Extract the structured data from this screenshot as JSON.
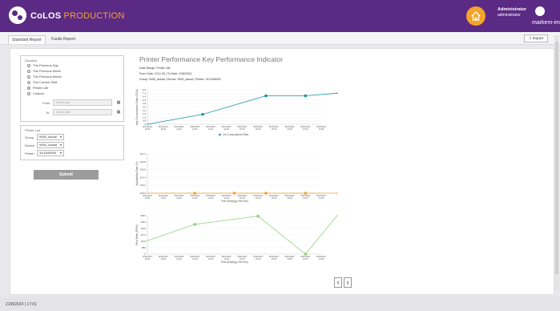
{
  "header": {
    "app_name": "CoLOS",
    "app_suffix": "PRODUCTION",
    "user_name": "Administrator",
    "user_role": "administrator",
    "brand": "markem-imaje",
    "accent_color": "#5b2a84",
    "home_color": "#f4a42a"
  },
  "tabs": [
    {
      "label": "Standard Report",
      "active": true
    },
    {
      "label": "Faults Report",
      "active": false
    }
  ],
  "export_label": "Export",
  "duration": {
    "title": "Duration",
    "options": [
      {
        "label": "The Previous Day",
        "selected": false
      },
      {
        "label": "The Previous Week",
        "selected": false
      },
      {
        "label": "The Previous Month",
        "selected": false
      },
      {
        "label": "The Current Shift",
        "selected": false
      },
      {
        "label": "Printer Life",
        "selected": true
      },
      {
        "label": "Custom",
        "selected": false
      }
    ],
    "from_label": "From",
    "to_label": "To",
    "from_placeholder": "Select date",
    "to_placeholder": "Select date"
  },
  "printer_list": {
    "title": "Printer List",
    "group_label": "Group",
    "group_value": "9450_actual",
    "device_label": "Device",
    "device_value": "9450_Actual",
    "printer_label": "Printer",
    "printer_value": "31/1645000"
  },
  "submit_label": "Submit",
  "report": {
    "title": "Printer Performance Key Performance Indicator",
    "date_range": "Date Range: Printer Life",
    "from_to": "From Date: 2/1/1 00   |   To Date: 31/8/2024",
    "group_line": "Group: 9450_actual   |   Device: 9450_actual   |   Printer: 31/1645000"
  },
  "chart_data": [
    {
      "type": "line",
      "ylabel": "Avg Consumption Rate (CC/h)",
      "xlabel": "",
      "yticks": [
        "8.0",
        "7.2",
        "6.4",
        "5.6",
        "4.8",
        "4.0",
        "3.2",
        "2.4",
        "1.6",
        "0.8",
        "0"
      ],
      "ylim": [
        0,
        8
      ],
      "categories": [
        "8/31/2024 15:00",
        "8/31/2024 15:20",
        "8/31/2024 13:40",
        "8/31/2024 14:00",
        "8/31/2024 14:20",
        "8/31/2024 14:40",
        "8/31/2024 15:00",
        "8/31/2024 15:20",
        "8/31/2024 15:40",
        "8/31/2024 16:00",
        "8/31/2024 16:20",
        "8/31/2024 16:40"
      ],
      "series": [
        {
          "name": "Ink Consumption Rate",
          "x": [
            0,
            3.5,
            7.5,
            10,
            12
          ],
          "values": [
            0,
            2.3,
            6.6,
            6.6,
            7.2
          ]
        }
      ],
      "color": "#1a93a0",
      "legend": "bottom-center"
    },
    {
      "type": "line",
      "ylabel": "Availability Rate (%)",
      "xlabel": "Time (M/d/yyyy HH:mm)",
      "yticks": [
        "101.0",
        "100.8",
        "100.6",
        "100.4",
        "100.2",
        "100.0"
      ],
      "ylim": [
        100,
        101
      ],
      "categories": [
        "8/31/2024 15:00",
        "8/31/2024 13:20",
        "8/31/2024 13:40",
        "8/31/2024 14:00",
        "8/31/2024 14:20",
        "8/31/2024 14:40",
        "8/31/2024 15:00",
        "8/31/2024 15:20",
        "8/31/2024 15:40",
        "8/31/2024 16:00",
        "8/31/2024 16:20",
        "8/31/2024 16:40"
      ],
      "series": [
        {
          "x": [
            0,
            3,
            5.5,
            7.5,
            10,
            12
          ],
          "values": [
            100,
            100,
            100,
            100,
            100,
            100
          ]
        }
      ],
      "color": "#f0a030"
    },
    {
      "type": "line",
      "ylabel": "Print Rate (PR/h)",
      "xlabel": "Time (M/d/yyyy HH:mm)",
      "yticks": [
        "2007",
        "1844",
        "1610",
        "1172",
        "1100",
        "880",
        "0"
      ],
      "ylim": [
        0,
        2007
      ],
      "categories": [
        "8/31/2024 15:00",
        "8/31/2024 13:20",
        "8/31/2024 13:40",
        "8/31/2024 14:00",
        "8/31/2024 14:20",
        "8/31/2024 14:40",
        "8/31/2024 15:00",
        "8/31/2024 15:20",
        "8/31/2024 15:40",
        "8/31/2024 16:00",
        "8/31/2024 16:20",
        "8/31/2024 16:40"
      ],
      "series": [
        {
          "x": [
            0,
            3,
            7,
            10,
            12
          ],
          "values": [
            700,
            1550,
            1980,
            0,
            2000
          ]
        }
      ],
      "color": "#8fd17a"
    }
  ],
  "footer": {
    "datetime": "21/8/2024 | 17:01"
  }
}
